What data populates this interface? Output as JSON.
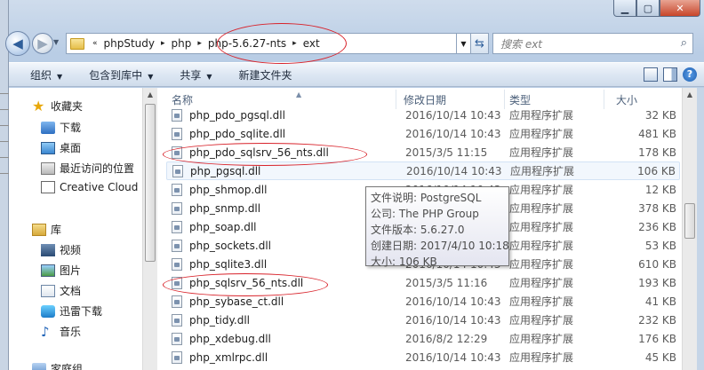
{
  "address": {
    "crumbs": [
      "phpStudy",
      "php",
      "php-5.6.27-nts",
      "ext"
    ],
    "overflow_marker": "«"
  },
  "search": {
    "placeholder": "搜索 ext"
  },
  "toolbar": {
    "organize": "组织",
    "include_in_library": "包含到库中",
    "share": "共享",
    "new_folder": "新建文件夹"
  },
  "nav": {
    "favorites": "收藏夹",
    "downloads": "下载",
    "desktop": "桌面",
    "recent": "最近访问的位置",
    "creative_cloud": "Creative Cloud",
    "libraries": "库",
    "videos": "视频",
    "pictures": "图片",
    "documents": "文档",
    "xunlei": "迅雷下载",
    "music": "音乐",
    "partial": "家庭组"
  },
  "columns": {
    "name": "名称",
    "date": "修改日期",
    "type": "类型",
    "size": "大小"
  },
  "files": [
    {
      "name": "php_pdo_pgsql.dll",
      "date": "2016/10/14 10:43",
      "type": "应用程序扩展",
      "size": "32 KB"
    },
    {
      "name": "php_pdo_sqlite.dll",
      "date": "2016/10/14 10:43",
      "type": "应用程序扩展",
      "size": "481 KB"
    },
    {
      "name": "php_pdo_sqlsrv_56_nts.dll",
      "date": "2015/3/5 11:15",
      "type": "应用程序扩展",
      "size": "178 KB"
    },
    {
      "name": "php_pgsql.dll",
      "date": "2016/10/14 10:43",
      "type": "应用程序扩展",
      "size": "106 KB"
    },
    {
      "name": "php_shmop.dll",
      "date": "2016/10/14 10:43",
      "type": "应用程序扩展",
      "size": "12 KB"
    },
    {
      "name": "php_snmp.dll",
      "date": "2016/10/14 10:43",
      "type": "应用程序扩展",
      "size": "378 KB"
    },
    {
      "name": "php_soap.dll",
      "date": "2016/10/14 10:43",
      "type": "应用程序扩展",
      "size": "236 KB"
    },
    {
      "name": "php_sockets.dll",
      "date": "2016/10/14 10:43",
      "type": "应用程序扩展",
      "size": "53 KB"
    },
    {
      "name": "php_sqlite3.dll",
      "date": "2016/10/14 10:43",
      "type": "应用程序扩展",
      "size": "610 KB"
    },
    {
      "name": "php_sqlsrv_56_nts.dll",
      "date": "2015/3/5 11:16",
      "type": "应用程序扩展",
      "size": "193 KB"
    },
    {
      "name": "php_sybase_ct.dll",
      "date": "2016/10/14 10:43",
      "type": "应用程序扩展",
      "size": "41 KB"
    },
    {
      "name": "php_tidy.dll",
      "date": "2016/10/14 10:43",
      "type": "应用程序扩展",
      "size": "232 KB"
    },
    {
      "name": "php_xdebug.dll",
      "date": "2016/8/2 12:29",
      "type": "应用程序扩展",
      "size": "176 KB"
    },
    {
      "name": "php_xmlrpc.dll",
      "date": "2016/10/14 10:43",
      "type": "应用程序扩展",
      "size": "45 KB"
    }
  ],
  "tooltip": {
    "description": "文件说明: PostgreSQL",
    "company": "公司: The PHP Group",
    "version": "文件版本: 5.6.27.0",
    "created": "创建日期: 2017/4/10 10:18",
    "size": "大小: 106 KB"
  },
  "colors": {
    "annotation": "#d8222a",
    "frame": "#b9cde5",
    "header_text": "#4c607a"
  }
}
